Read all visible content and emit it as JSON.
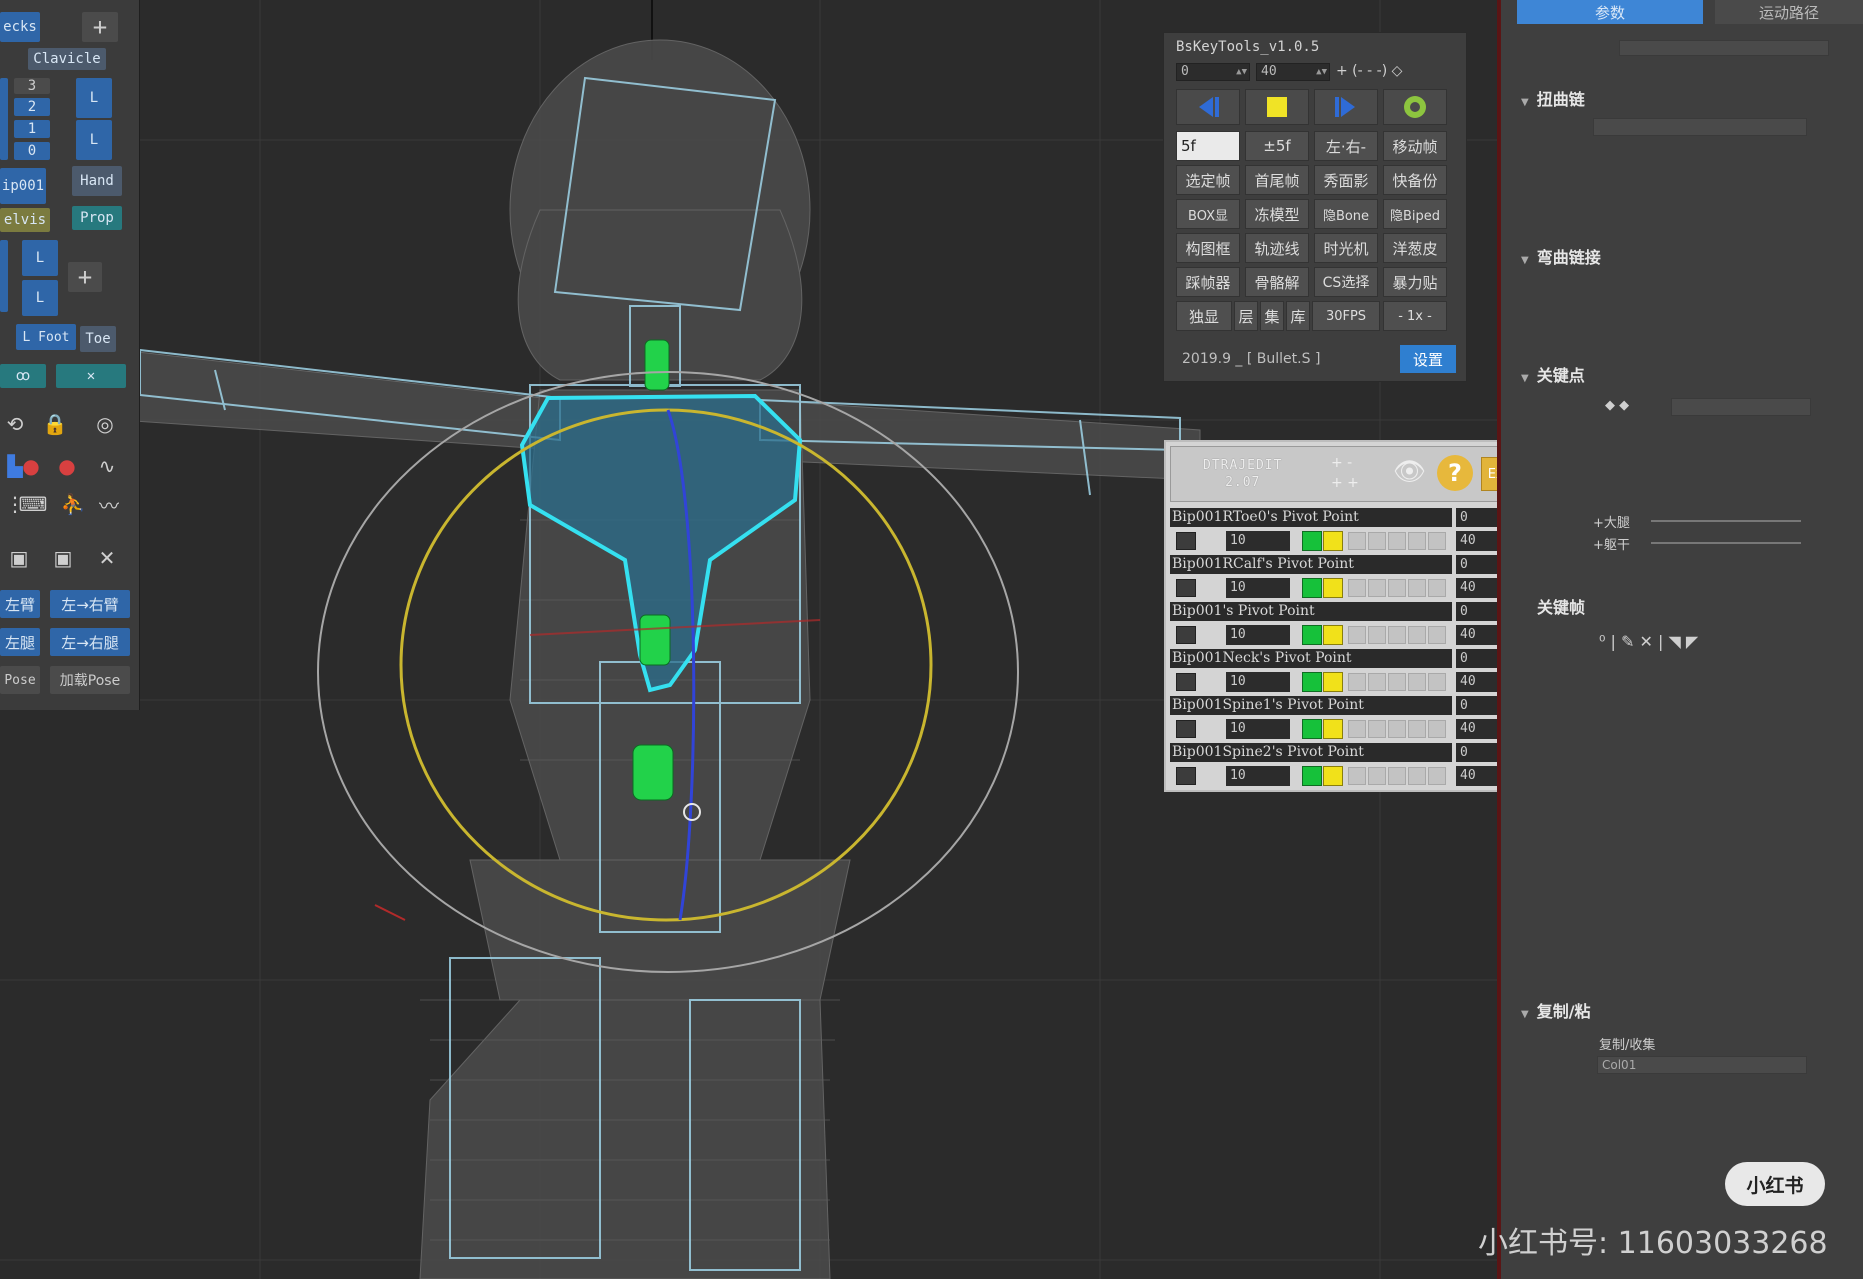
{
  "biped_panel": {
    "top_buttons": {
      "tab_fragment": "ecks",
      "add": "+",
      "clavicle": "Clavicle"
    },
    "spine_numbers": [
      "3",
      "2",
      "1",
      "0"
    ],
    "l_buttons": [
      "L",
      "L",
      "L",
      "L"
    ],
    "bip_label": "ip001",
    "hand": "Hand",
    "pelvis_fragment": "elvis",
    "prop": "Prop",
    "add_leg": "+",
    "l_foot": "L Foot",
    "toe": "Toe",
    "cn_buttons": {
      "left_arm": "左臂",
      "arm_lr": "左→右臂",
      "left_leg": "左腿",
      "leg_lr": "左→右腿",
      "pose": "Pose",
      "load_pose": "加载Pose"
    }
  },
  "bskeytools": {
    "title": "BsKeyTools_v1.0.5",
    "start_value": "0",
    "end_value": "40",
    "range_controls": "+ (- - -) ◇",
    "frame_field": "5f",
    "buttons": [
      "±5f",
      "左·右-",
      "移动帧",
      "选定帧",
      "首尾帧",
      "秀面影",
      "快备份",
      "BOX显",
      "冻模型",
      "隐Bone",
      "隐Biped",
      "构图框",
      "轨迹线",
      "时光机",
      "洋葱皮",
      "踩帧器",
      "骨骼解",
      "CS选择",
      "暴力贴",
      "独显",
      "层",
      "集",
      "库",
      "30FPS",
      "- 1x -"
    ],
    "footer": "2019.9 _ [ Bullet.S ]",
    "settings": "设置",
    "colors": {
      "prev": "#2f6bd6",
      "stop": "#f0e326",
      "next": "#2f6bd6",
      "gear": "#8dc53f"
    }
  },
  "dtrajedit": {
    "title_line1": "DTRAJEDIT",
    "title_line2": "2.07",
    "rows": [
      {
        "name": "Bip001RToe0's Pivot Point",
        "value": "0",
        "frame": "10",
        "end": "40"
      },
      {
        "name": "Bip001RCalf's Pivot Point",
        "value": "0",
        "frame": "10",
        "end": "40"
      },
      {
        "name": "Bip001's Pivot Point",
        "value": "0",
        "frame": "10",
        "end": "40"
      },
      {
        "name": "Bip001Neck's Pivot Point",
        "value": "0",
        "frame": "10",
        "end": "40"
      },
      {
        "name": "Bip001Spine1's Pivot Point",
        "value": "0",
        "frame": "10",
        "end": "40"
      },
      {
        "name": "Bip001Spine2's Pivot Point",
        "value": "0",
        "frame": "10",
        "end": "40"
      }
    ],
    "exit": "Exit"
  },
  "command_panel": {
    "tabs": [
      "参数",
      "运动路径"
    ],
    "rollouts": [
      "扭曲链",
      "弯曲链接",
      "关键点",
      "关键帧",
      "复制/粘"
    ],
    "slider_labels": [
      "+大腿",
      "+躯干"
    ],
    "copy_collection_label": "复制/收集",
    "copy_collection_value": "Col01"
  },
  "watermark": {
    "badge": "小红书",
    "id_text": "小红书号: 11603033268"
  }
}
